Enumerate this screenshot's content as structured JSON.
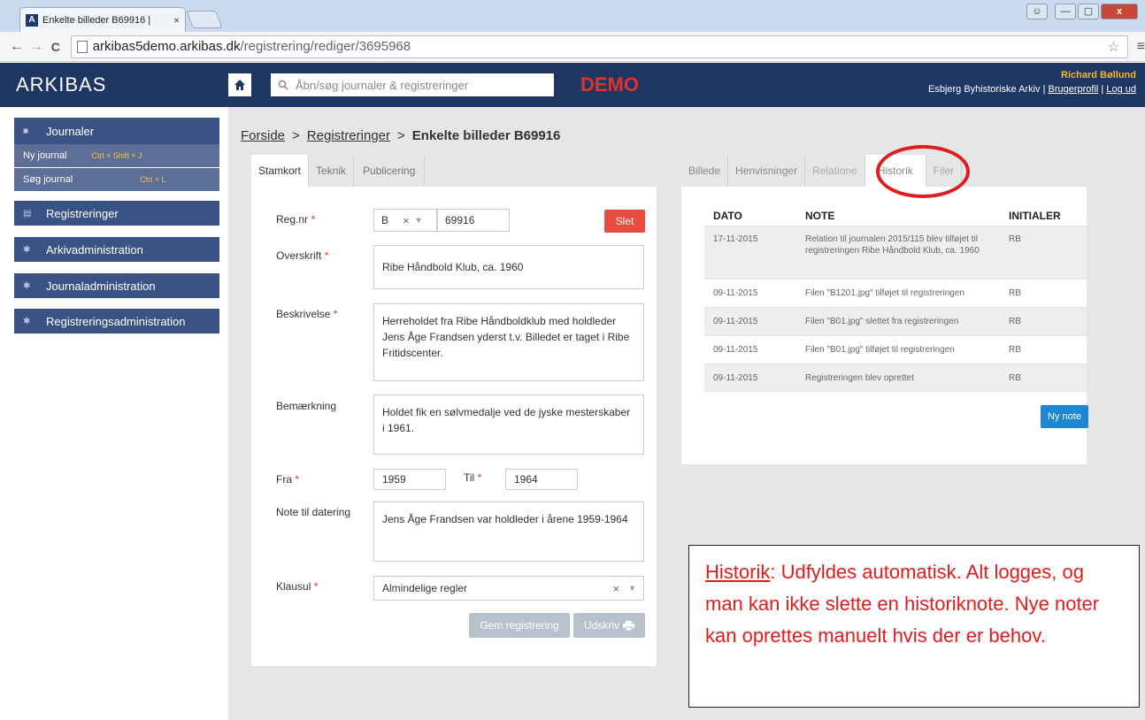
{
  "browser": {
    "tab_title": "Enkelte billeder B69916 | ",
    "tab_close": "×",
    "url_host": "arkibas5demo.arkibas.dk",
    "url_path": "/registrering/rediger/3695968",
    "back": "←",
    "forward": "→",
    "reload": "C",
    "star": "☆",
    "menu": "≡",
    "window_buttons": [
      "—",
      "▢",
      "x"
    ]
  },
  "header": {
    "logo": "ARKIBAS",
    "home_icon": "home-icon",
    "search_placeholder": "Åbn/søg journaler & registreringer",
    "demo": "DEMO",
    "user_name": "Richard Bøllund",
    "org": "Esbjerg Byhistoriske Arkiv | ",
    "profile_link": "Brugerprofil",
    "logout_link": "Log ud"
  },
  "sidebar": {
    "journaler": "Journaler",
    "ny_journal": "Ny journal",
    "ny_journal_shortcut": "Ctrl + Shift + J",
    "sog_journal": "Søg journal",
    "sog_journal_shortcut": "Ctrl + L",
    "registreringer": "Registreringer",
    "arkivadministration": "Arkivadministration",
    "journaladministration": "Journaladministration",
    "registreringsadministration": "Registreringsadministration"
  },
  "breadcrumb": {
    "home": "Forside",
    "section": "Registreringer",
    "current": "Enkelte billeder B69916"
  },
  "left_tabs": [
    "Stamkort",
    "Teknik",
    "Publicering"
  ],
  "form": {
    "regnr_label": "Reg.nr",
    "regnr_prefix": "B",
    "regnr_number": "69916",
    "slet": "Slet",
    "overskrift_label": "Overskrift",
    "overskrift": "Ribe Håndbold Klub, ca. 1960",
    "beskrivelse_label": "Beskrivelse",
    "beskrivelse": "Herreholdet fra Ribe Håndboldklub med holdleder Jens Åge Frandsen yderst t.v. Billedet er taget i Ribe Fritidscenter.",
    "bemaerkning_label": "Bemærkning",
    "bemaerkning": "Holdet fik en sølvmedalje ved de jyske mesterskaber i 1961.",
    "fra_label": "Fra",
    "fra": "1959",
    "til_label": "Til",
    "til": "1964",
    "note_label": "Note til datering",
    "note": "Jens Åge Frandsen var holdleder i årene 1959-1964",
    "klausul_label": "Klausul",
    "klausul": "Almindelige regler",
    "gem": "Gem registrering",
    "udskriv": "Udskriv",
    "required_mark": "*"
  },
  "right_tabs": [
    "Billede",
    "Henvisninger",
    "Relatione",
    "Historik",
    "Filer"
  ],
  "history": {
    "headers": [
      "DATO",
      "NOTE",
      "INITIALER"
    ],
    "rows": [
      {
        "date": "17-11-2015",
        "note": "Relation til journalen 2015/115 blev tilføjet til registreringen Ribe Håndbold Klub, ca. 1960",
        "init": "RB"
      },
      {
        "date": "09-11-2015",
        "note": "Filen \"B1201.jpg\" tilføjet til registreringen",
        "init": "RB"
      },
      {
        "date": "09-11-2015",
        "note": "Filen \"B01.jpg\" slettet fra registreringen",
        "init": "RB"
      },
      {
        "date": "09-11-2015",
        "note": "Filen \"B01.jpg\" tilføjet til registreringen",
        "init": "RB"
      },
      {
        "date": "09-11-2015",
        "note": "Registreringen blev oprettet",
        "init": "RB"
      }
    ],
    "ny_note": "Ny note"
  },
  "callout": {
    "keyword": "Historik",
    "text": ": Udfyldes automatisk. Alt logges, og man kan ikke slette en historiknote. Nye noter kan oprettes manuelt hvis der er behov."
  }
}
